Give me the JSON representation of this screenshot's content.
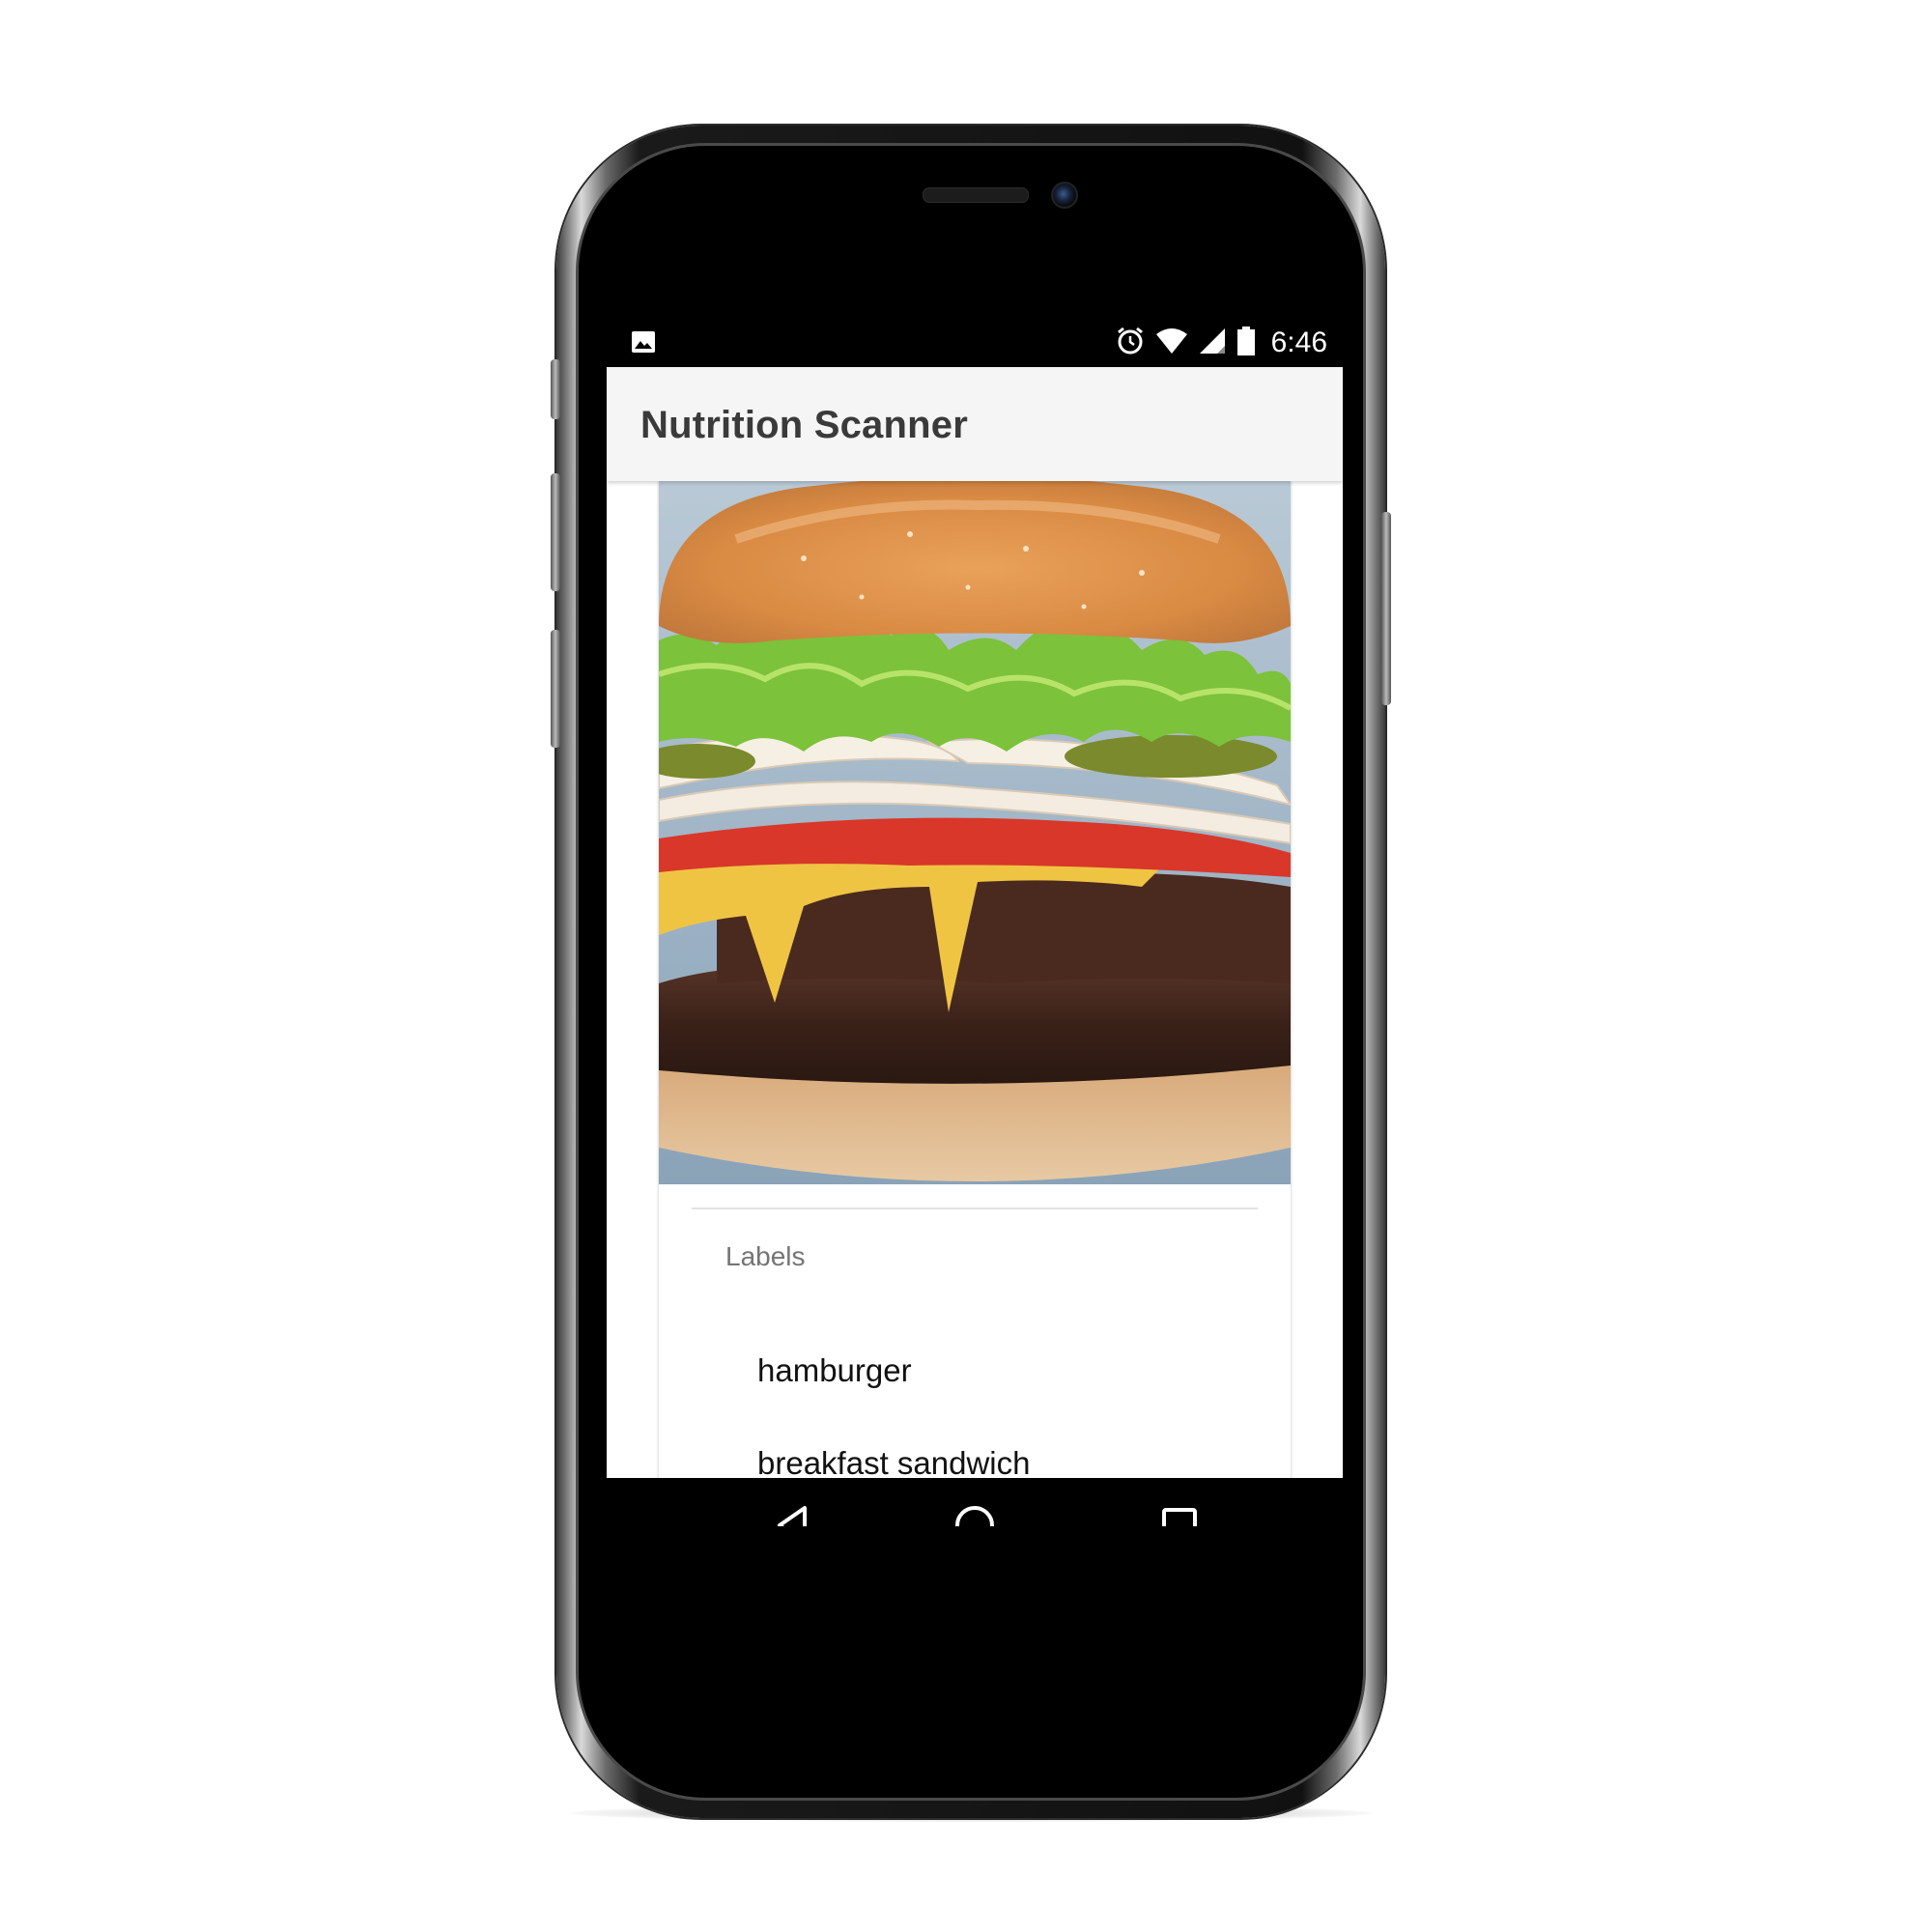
{
  "status_bar": {
    "notification_icon": "image-icon",
    "icons": [
      "alarm-icon",
      "wifi-icon",
      "signal-icon",
      "battery-icon"
    ],
    "time": "6:46"
  },
  "app_bar": {
    "title": "Nutrition Scanner"
  },
  "content": {
    "image": {
      "icon": "hamburger-photo"
    },
    "labels_heading": "Labels",
    "labels": [
      "hamburger",
      "breakfast sandwich"
    ]
  },
  "nav_bar": {
    "buttons": [
      "back-icon",
      "home-icon",
      "recents-icon"
    ]
  },
  "colors": {
    "app_bar_bg": "#f5f5f5",
    "title_text": "#3a3a3a",
    "heading_text": "#757575",
    "label_text": "#111111",
    "screen_bg": "#ffffff",
    "system_bars": "#000000"
  }
}
